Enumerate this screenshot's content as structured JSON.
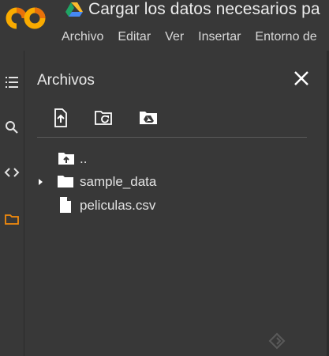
{
  "header": {
    "title": "Cargar los datos necesarios pa",
    "menu": [
      "Archivo",
      "Editar",
      "Ver",
      "Insertar",
      "Entorno de"
    ]
  },
  "rail": {
    "items": [
      "table-of-contents-icon",
      "search-icon",
      "code-snippets-icon",
      "folder-icon"
    ],
    "active": "folder-icon"
  },
  "panel": {
    "title": "Archivos",
    "toolbar": [
      "upload-icon",
      "refresh-folder-icon",
      "mount-drive-icon"
    ],
    "tree": [
      {
        "name": "..",
        "kind": "parent"
      },
      {
        "name": "sample_data",
        "kind": "folder",
        "expandable": true
      },
      {
        "name": "peliculas.csv",
        "kind": "file"
      }
    ]
  },
  "colors": {
    "background": "#383838",
    "accent_orange": "#f9ab00",
    "active_icon": "#f28b0c",
    "text": "#e3e3e3"
  }
}
